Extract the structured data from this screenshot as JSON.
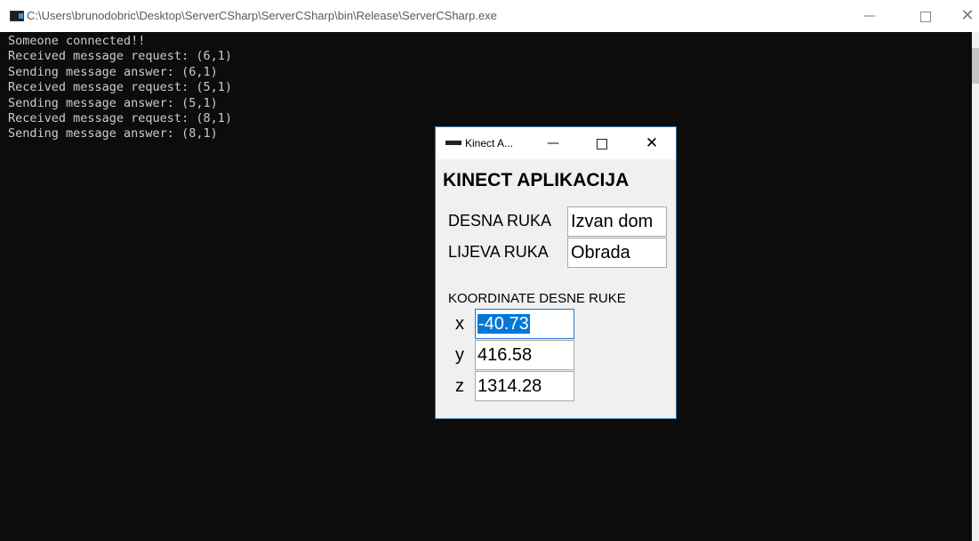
{
  "console": {
    "title": "C:\\Users\\brunodobric\\Desktop\\ServerCSharp\\ServerCSharp\\bin\\Release\\ServerCSharp.exe",
    "controls": {
      "minimize": "—",
      "close": "✕"
    },
    "output": "Someone connected!!\nReceived message request: (6,1)\nSending message answer: (6,1)\nReceived message request: (5,1)\nSending message answer: (5,1)\nReceived message request: (8,1)\nSending message answer: (8,1)"
  },
  "dialog": {
    "title": "Kinect A...",
    "controls": {
      "minimize": "—",
      "close": "✕"
    },
    "heading": "KINECT APLIKACIJA",
    "right_hand": {
      "label": "DESNA RUKA",
      "value": "Izvan dom"
    },
    "left_hand": {
      "label": "LIJEVA RUKA",
      "value": "Obrada"
    },
    "coords": {
      "heading": "KOORDINATE DESNE RUKE",
      "x": {
        "label": "x",
        "value": "-40.73"
      },
      "y": {
        "label": "y",
        "value": "416.58"
      },
      "z": {
        "label": "z",
        "value": "1314.28"
      }
    }
  }
}
